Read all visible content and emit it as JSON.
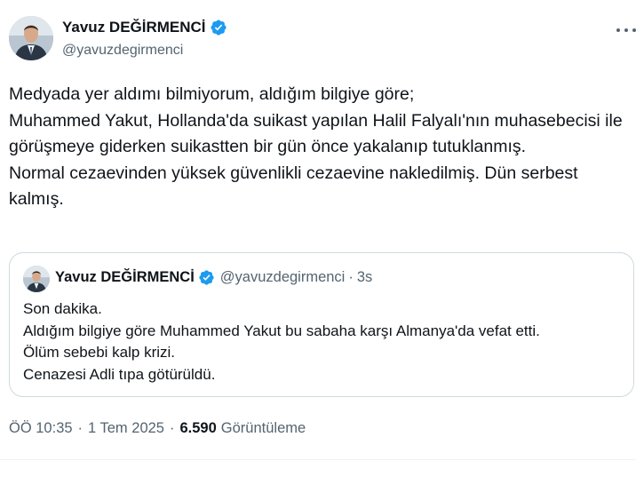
{
  "author": {
    "name": "Yavuz DEĞİRMENCİ",
    "handle": "@yavuzdegirmenci",
    "verified": true
  },
  "tweet": {
    "text": "Medyada yer aldımı bilmiyorum, aldığım bilgiye göre;\nMuhammed Yakut, Hollanda'da suikast yapılan Halil Falyalı'nın muhasebecisi ile görüşmeye giderken suikastten bir gün önce yakalanıp tutuklanmış.\nNormal cezaevinden yüksek güvenlikli cezaevine nakledilmiş. Dün serbest kalmış."
  },
  "quoted": {
    "name": "Yavuz DEĞİRMENCİ",
    "handle": "@yavuzdegirmenci",
    "dot": "·",
    "time": "3s",
    "text": "Son dakika.\nAldığım bilgiye göre Muhammed Yakut bu sabaha karşı Almanya'da vefat etti.\nÖlüm sebebi kalp krizi.\nCenazesi Adli tıpa götürüldü."
  },
  "meta": {
    "time": "ÖÖ 10:35",
    "sep": "·",
    "date": "1 Tem 2025",
    "views_count": "6.590",
    "views_label": "Görüntüleme"
  },
  "colors": {
    "verified": "#1d9bf0",
    "muted": "#536471",
    "text": "#0f1419",
    "border": "#cfd9de"
  },
  "icons": {
    "verified": "verified-badge-icon",
    "more": "more-horizontal-icon"
  }
}
